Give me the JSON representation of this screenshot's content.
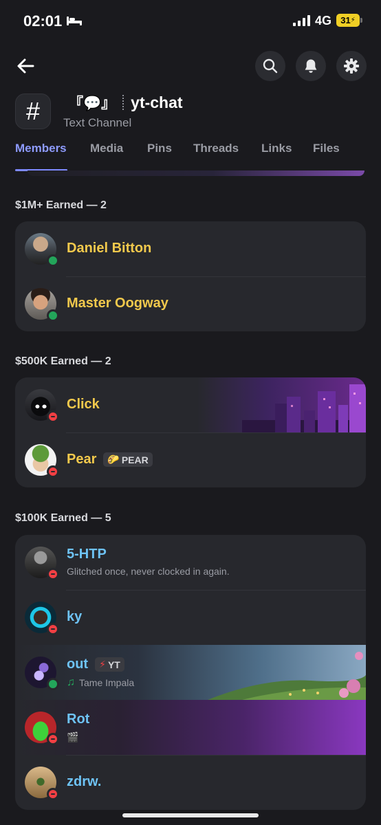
{
  "status_bar": {
    "time": "02:01",
    "network": "4G",
    "battery": "31"
  },
  "channel": {
    "emoji_prefix": "『💬』",
    "name": "yt-chat",
    "type_label": "Text Channel"
  },
  "tabs": [
    "Members",
    "Media",
    "Pins",
    "Threads",
    "Links",
    "Files"
  ],
  "active_tab": "Members",
  "sections": [
    {
      "header": "$1M+ Earned — 2",
      "members": [
        {
          "name": "Daniel Bitton",
          "status": "online"
        },
        {
          "name": "Master Oogway",
          "status": "online"
        }
      ]
    },
    {
      "header": "$500K Earned — 2",
      "members": [
        {
          "name": "Click",
          "status": "dnd"
        },
        {
          "name": "Pear",
          "status": "dnd",
          "tag": "PEAR",
          "tag_icon": "🌮"
        }
      ]
    },
    {
      "header": "$100K Earned — 5",
      "members": [
        {
          "name": "5-HTP",
          "status": "dnd",
          "activity": "Glitched once, never clocked in again."
        },
        {
          "name": "ky",
          "status": "dnd"
        },
        {
          "name": "out",
          "status": "online",
          "tag": "YT",
          "tag_icon": "⚡",
          "activity": "Tame Impala",
          "activity_icon": "♫"
        },
        {
          "name": "Rot",
          "status": "dnd",
          "activity_icon": "🎬"
        },
        {
          "name": "zdrw.",
          "status": "dnd"
        }
      ]
    }
  ],
  "colors": {
    "gold_name": "#f2c94c",
    "blue_name": "#6ec3f5",
    "accent": "#8e9bff",
    "online": "#23a55a",
    "dnd": "#f23f43"
  }
}
